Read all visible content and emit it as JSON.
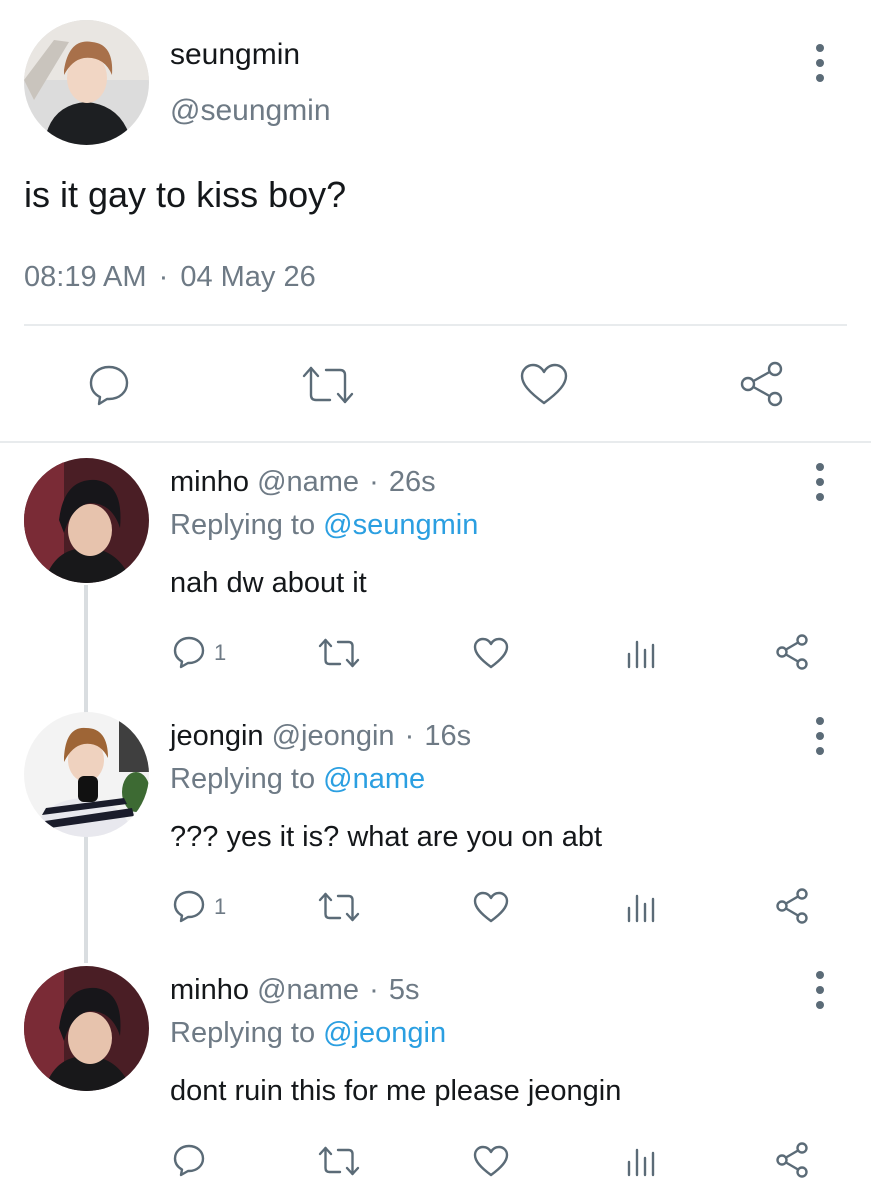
{
  "main_tweet": {
    "display_name": "seungmin",
    "handle": "@seungmin",
    "text": "is it gay to kiss boy?",
    "time": "08:19 AM",
    "separator": "·",
    "date": "04 May 26"
  },
  "replies": [
    {
      "display_name": "minho",
      "handle": "@name",
      "separator": "·",
      "time": "26s",
      "replying_prefix": "Replying to",
      "replying_to": "@seungmin",
      "text": "nah dw about it",
      "reply_count": "1"
    },
    {
      "display_name": "jeongin",
      "handle": "@jeongin",
      "separator": "·",
      "time": "16s",
      "replying_prefix": "Replying to",
      "replying_to": "@name",
      "text": "??? yes it is? what are you on abt",
      "reply_count": "1"
    },
    {
      "display_name": "minho",
      "handle": "@name",
      "separator": "·",
      "time": "5s",
      "replying_prefix": "Replying to",
      "replying_to": "@jeongin",
      "text": "dont ruin this for me please jeongin",
      "reply_count": ""
    }
  ],
  "colors": {
    "accent": "#2b9fe1",
    "icon": "#5b6b77",
    "muted": "#6e7a85"
  },
  "icons": [
    "reply-icon",
    "retweet-icon",
    "like-icon",
    "analytics-icon",
    "share-icon",
    "more-icon"
  ]
}
